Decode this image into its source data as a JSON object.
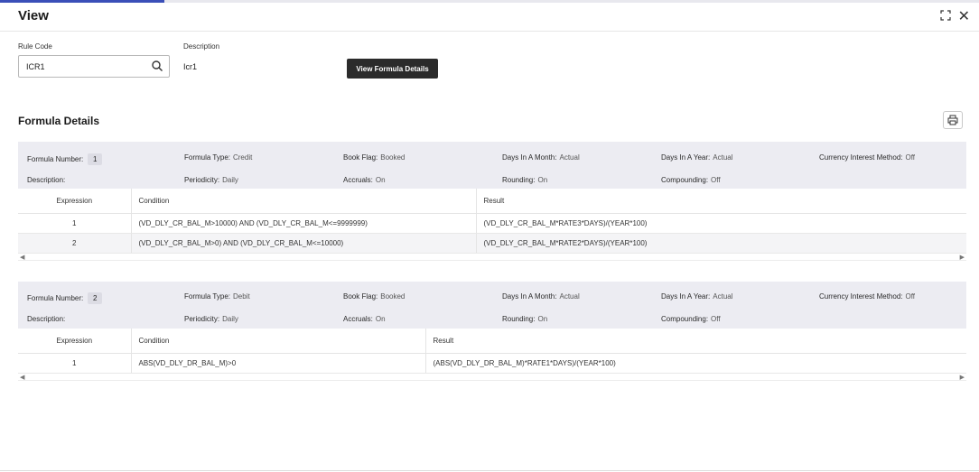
{
  "window": {
    "title": "View",
    "expand_icon": "expand-icon",
    "close_icon": "close-icon"
  },
  "form": {
    "rule_code_label": "Rule Code",
    "rule_code_value": "ICR1",
    "description_label": "Description",
    "description_value": "Icr1",
    "view_button_label": "View Formula Details"
  },
  "section": {
    "title": "Formula Details",
    "print_icon": "printer-icon"
  },
  "formulas": [
    {
      "formula_number_label": "Formula Number:",
      "formula_number": "1",
      "formula_type_label": "Formula Type:",
      "formula_type": "Credit",
      "book_flag_label": "Book Flag:",
      "book_flag": "Booked",
      "days_month_label": "Days In A Month:",
      "days_month": "Actual",
      "days_year_label": "Days In A Year:",
      "days_year": "Actual",
      "cim_label": "Currency Interest Method:",
      "cim": "Off",
      "description_label": "Description:",
      "periodicity_label": "Periodicity:",
      "periodicity": "Daily",
      "accruals_label": "Accruals:",
      "accruals": "On",
      "rounding_label": "Rounding:",
      "rounding": "On",
      "compounding_label": "Compounding:",
      "compounding": "Off",
      "columns": [
        "Expression",
        "Condition",
        "Result"
      ],
      "rows": [
        {
          "expression": "1",
          "condition": "(VD_DLY_CR_BAL_M>10000) AND (VD_DLY_CR_BAL_M<=9999999)",
          "result": "(VD_DLY_CR_BAL_M*RATE3*DAYS)/(YEAR*100)"
        },
        {
          "expression": "2",
          "condition": "(VD_DLY_CR_BAL_M>0) AND (VD_DLY_CR_BAL_M<=10000)",
          "result": "(VD_DLY_CR_BAL_M*RATE2*DAYS)/(YEAR*100)"
        }
      ]
    },
    {
      "formula_number_label": "Formula Number:",
      "formula_number": "2",
      "formula_type_label": "Formula Type:",
      "formula_type": "Debit",
      "book_flag_label": "Book Flag:",
      "book_flag": "Booked",
      "days_month_label": "Days In A Month:",
      "days_month": "Actual",
      "days_year_label": "Days In A Year:",
      "days_year": "Actual",
      "cim_label": "Currency Interest Method:",
      "cim": "Off",
      "description_label": "Description:",
      "periodicity_label": "Periodicity:",
      "periodicity": "Daily",
      "accruals_label": "Accruals:",
      "accruals": "On",
      "rounding_label": "Rounding:",
      "rounding": "On",
      "compounding_label": "Compounding:",
      "compounding": "Off",
      "columns": [
        "Expression",
        "Condition",
        "Result"
      ],
      "rows": [
        {
          "expression": "1",
          "condition": "ABS(VD_DLY_DR_BAL_M)>0",
          "result": "(ABS(VD_DLY_DR_BAL_M)*RATE1*DAYS)/(YEAR*100)"
        }
      ]
    }
  ],
  "colors": {
    "accent": "#3a4fb8",
    "button_dark": "#2b2b2b",
    "header_band": "#ececf2"
  }
}
